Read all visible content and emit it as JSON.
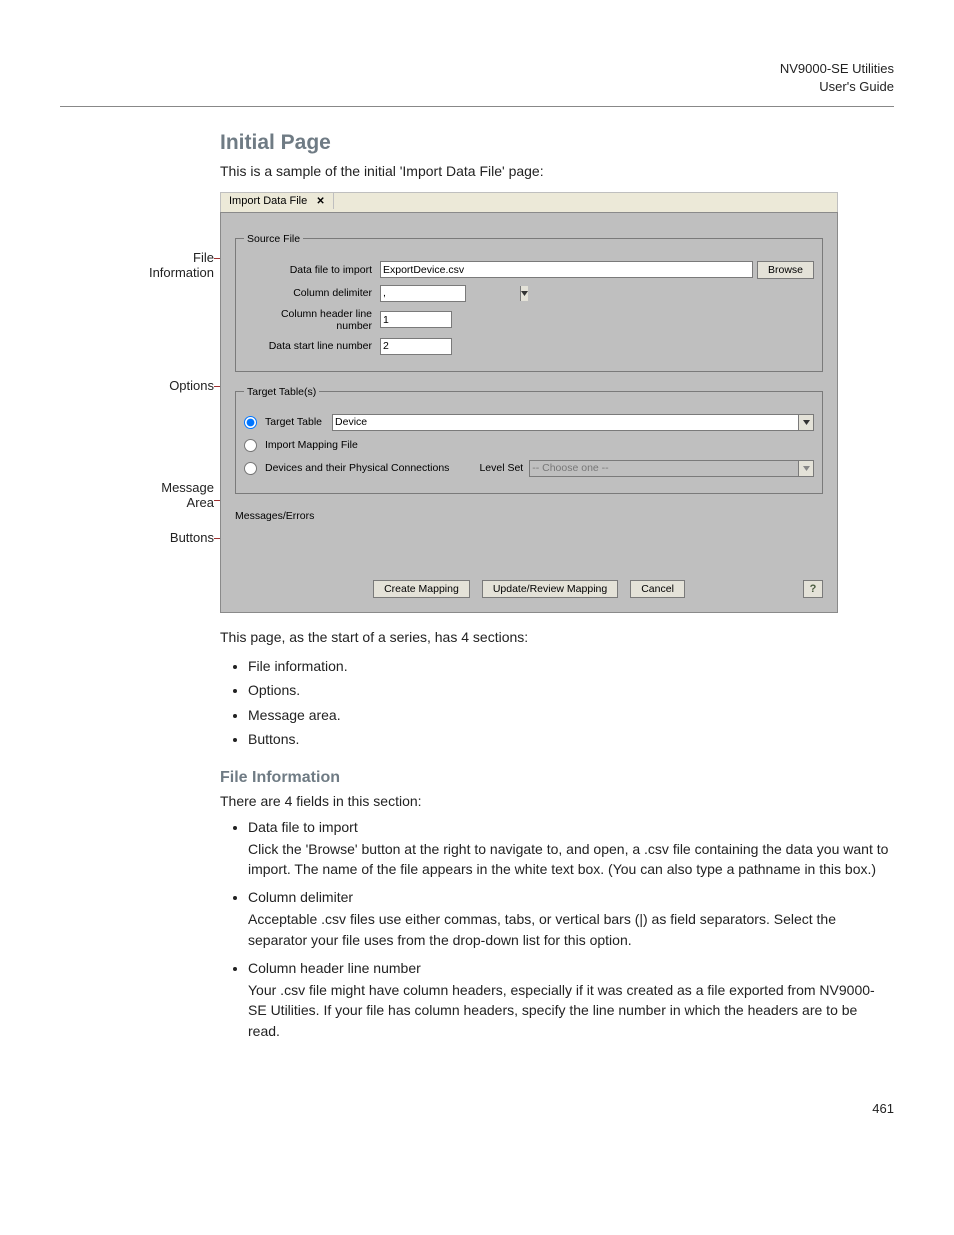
{
  "header": {
    "product": "NV9000-SE Utilities",
    "doc": "User's Guide"
  },
  "headings": {
    "initial_page": "Initial Page",
    "file_info": "File Information"
  },
  "intro": "This is a sample of the initial 'Import Data File' page:",
  "after_fig": "This page, as the start of a series, has 4 sections:",
  "sections_list": [
    "File information.",
    "Options.",
    "Message area.",
    "Buttons."
  ],
  "file_info_intro": "There are 4 fields in this section:",
  "file_info_items": [
    {
      "title": "Data file to import",
      "body": "Click the 'Browse' button at the right to navigate to, and open, a .csv file containing the data you want to import. The name of the file appears in the white text box. (You can also type a pathname in this box.)"
    },
    {
      "title": "Column delimiter",
      "body": "Acceptable .csv files use either commas, tabs, or vertical bars (|) as field separators. Select the separator your file uses from the drop-down list for this option."
    },
    {
      "title": "Column header line number",
      "body": "Your .csv file might have column headers, especially if it was created as a file exported from NV9000-SE Utilities. If your file has column headers, specify the line number in which the headers are to be read."
    }
  ],
  "callouts": {
    "file_info": "File\nInformation",
    "options": "Options",
    "message": "Message\nArea",
    "buttons": "Buttons"
  },
  "ui": {
    "tab_title": "Import Data File",
    "source_file": {
      "legend": "Source File",
      "data_file_label": "Data file to import",
      "data_file_value": "ExportDevice.csv",
      "browse": "Browse",
      "delimiter_label": "Column delimiter",
      "delimiter_value": ",",
      "header_line_label": "Column header line number",
      "header_line_value": "1",
      "data_start_label": "Data start line number",
      "data_start_value": "2"
    },
    "target": {
      "legend": "Target Table(s)",
      "opt_target_table": "Target Table",
      "target_table_value": "Device",
      "opt_import_mapping": "Import Mapping File",
      "opt_devices_phys": "Devices and their Physical Connections",
      "level_set_label": "Level Set",
      "level_set_value": "-- Choose one --"
    },
    "messages_label": "Messages/Errors",
    "buttons": {
      "create": "Create Mapping",
      "update": "Update/Review Mapping",
      "cancel": "Cancel"
    }
  },
  "page_number": "461"
}
